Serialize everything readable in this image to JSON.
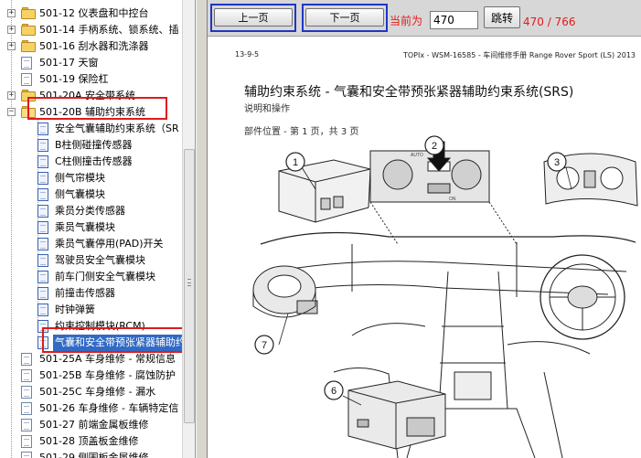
{
  "tree": {
    "items": [
      {
        "label": "501-12 仪表盘和中控台",
        "type": "folder",
        "expander": "+"
      },
      {
        "label": "501-14 手柄系统、锁系统、插",
        "type": "folder",
        "expander": "+"
      },
      {
        "label": "501-16 刮水器和洗涤器",
        "type": "folder",
        "expander": "+"
      },
      {
        "label": "501-17 天窗",
        "type": "doc"
      },
      {
        "label": "501-19 保险杠",
        "type": "doc"
      },
      {
        "label": "501-20A 安全带系统",
        "type": "folder",
        "expander": "+"
      },
      {
        "label": "501-20B 辅助约束系统",
        "type": "folder-open",
        "expander": "−"
      },
      {
        "label": "安全气囊辅助约束系统（SR",
        "type": "doc-child"
      },
      {
        "label": "B柱侧碰撞传感器",
        "type": "doc-child"
      },
      {
        "label": "C柱侧撞击传感器",
        "type": "doc-child"
      },
      {
        "label": "侧气帘模块",
        "type": "doc-child"
      },
      {
        "label": "侧气囊模块",
        "type": "doc-child"
      },
      {
        "label": "乘员分类传感器",
        "type": "doc-child"
      },
      {
        "label": "乘员气囊模块",
        "type": "doc-child"
      },
      {
        "label": "乘员气囊停用(PAD)开关",
        "type": "doc-child"
      },
      {
        "label": "驾驶员安全气囊模块",
        "type": "doc-child"
      },
      {
        "label": "前车门侧安全气囊模块",
        "type": "doc-child"
      },
      {
        "label": "前撞击传感器",
        "type": "doc-child"
      },
      {
        "label": "时钟弹簧",
        "type": "doc-child"
      },
      {
        "label": "约束控制模块(RCM)",
        "type": "doc-child"
      },
      {
        "label": "气囊和安全带预张紧器辅助约",
        "type": "doc-child-selected"
      },
      {
        "label": "501-25A 车身维修 - 常规信息",
        "type": "doc"
      },
      {
        "label": "501-25B 车身维修 - 腐蚀防护",
        "type": "doc"
      },
      {
        "label": "501-25C 车身维修 - 漏水",
        "type": "doc"
      },
      {
        "label": "501-26 车身维修 - 车辆特定信",
        "type": "doc"
      },
      {
        "label": "501-27 前端金属板维修",
        "type": "doc"
      },
      {
        "label": "501-28 顶盖板金维修",
        "type": "doc"
      },
      {
        "label": "501-29 侧围板金属维修",
        "type": "doc"
      }
    ]
  },
  "toolbar": {
    "prev_label": "上一页",
    "next_label": "下一页",
    "current_label": "当前为",
    "page_value": "470",
    "go_label": "跳转",
    "page_count": "470 / 766"
  },
  "document": {
    "header_left": "13-9-5",
    "header_right": "TOPIx - WSM-16585 - 车间维修手册 Range Rover Sport (LS) 2013",
    "title": "辅助约束系统 - 气囊和安全带预张紧器辅助约束系统(SRS)",
    "subtitle": "说明和操作",
    "section": "部件位置 - 第 1 页，共 3 页",
    "callouts": [
      "1",
      "2",
      "3",
      "6",
      "7"
    ],
    "panel_text_auto": "AUTO",
    "panel_text_on": "ON"
  },
  "colors": {
    "highlight_red": "#e01a1a",
    "toolbar_frame_blue": "#1f36c4",
    "counter_red": "#e8191a",
    "selection_blue": "#316ac5"
  }
}
